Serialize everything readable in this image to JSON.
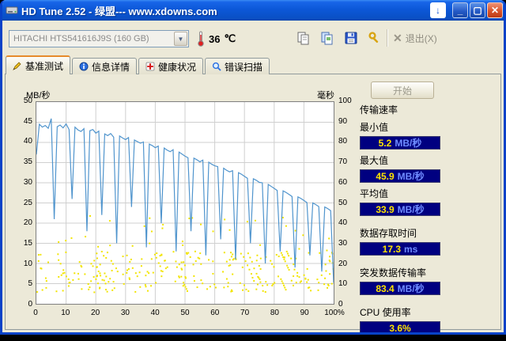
{
  "window": {
    "title": "HD Tune 2.52 - 绿盟--- www.xdowns.com",
    "controls": {
      "download": "↓",
      "minimize": "_",
      "maximize": "▢",
      "close": "✕"
    }
  },
  "toolbar": {
    "drive_select": "HITACHI HTS541616J9S (160 GB)",
    "drive_dropdown_glyph": "▼",
    "temperature_value": "36",
    "temperature_unit": "℃",
    "exit_x_glyph": "✕",
    "exit_label": "退出(X)"
  },
  "icons": [
    "hdd-app-icon",
    "download-icon",
    "thermometer-icon",
    "copy-icon",
    "copy-image-icon",
    "save-icon",
    "settings-icon",
    "exit-x-icon",
    "benchmark-tab-icon",
    "info-tab-icon",
    "health-tab-icon",
    "scan-tab-icon",
    "dropdown-arrow-icon"
  ],
  "tabs": [
    {
      "label": "基准测试",
      "active": true
    },
    {
      "label": "信息详情",
      "active": false
    },
    {
      "label": "健康状况",
      "active": false
    },
    {
      "label": "错误扫描",
      "active": false
    }
  ],
  "page": {
    "start_button": "开始",
    "axis_left_title": "MB/秒",
    "axis_right_title": "毫秒"
  },
  "results": {
    "transfer_header": "传输速率",
    "min_label": "最小值",
    "min_value": "5.2",
    "min_unit": "MB/秒",
    "max_label": "最大值",
    "max_value": "45.9",
    "max_unit": "MB/秒",
    "avg_label": "平均值",
    "avg_value": "33.9",
    "avg_unit": "MB/秒",
    "access_label": "数据存取时间",
    "access_value": "17.3",
    "access_unit": "ms",
    "burst_label": "突发数据传输率",
    "burst_value": "83.4",
    "burst_unit": "MB/秒",
    "cpu_label": "CPU 使用率",
    "cpu_value": "3.6%"
  },
  "chart_data": {
    "type": "line",
    "title": "HD Tune benchmark transfer rate and access time",
    "x_ticks": [
      "0",
      "10",
      "20",
      "30",
      "40",
      "50",
      "60",
      "70",
      "80",
      "90",
      "100%"
    ],
    "left_ticks": [
      "50",
      "45",
      "40",
      "35",
      "30",
      "25",
      "20",
      "15",
      "10",
      "5",
      "0"
    ],
    "right_ticks": [
      "100",
      "90",
      "80",
      "70",
      "60",
      "50",
      "40",
      "30",
      "20",
      "10",
      "0"
    ],
    "left_range": [
      0,
      50
    ],
    "right_range": [
      0,
      100
    ],
    "x_range": [
      0,
      100
    ],
    "grid": true,
    "series": [
      {
        "name": "transfer-rate-mb-per-s",
        "values": [
          37,
          44.5,
          43.8,
          44.2,
          43.5,
          45.9,
          21,
          43.9,
          44.3,
          43.6,
          44.6,
          43.2,
          26,
          43.8,
          43.1,
          42.7,
          43.4,
          18,
          42.9,
          43.2,
          42.3,
          42.8,
          22,
          42.1,
          41.7,
          42.2,
          41.3,
          15,
          41.6,
          41.1,
          40.7,
          41.2,
          24,
          40.6,
          40.2,
          39.8,
          40.1,
          14,
          39.6,
          39.2,
          38.7,
          39.1,
          20,
          38.6,
          38.1,
          37.7,
          38.2,
          13,
          37.6,
          37.1,
          36.6,
          36.2,
          18,
          36.1,
          35.7,
          35.2,
          35.6,
          12,
          35.1,
          34.6,
          34.2,
          34,
          16,
          33.6,
          33.1,
          32.7,
          33,
          11,
          32.5,
          32.1,
          31.6,
          31.1,
          15,
          31,
          30.6,
          30.1,
          30,
          10,
          29.6,
          29.1,
          28.6,
          28.1,
          13,
          28,
          27.6,
          27.1,
          26.6,
          9,
          26.5,
          26.1,
          25.6,
          25.1,
          12,
          25,
          24.6,
          24.1,
          8,
          24,
          23.6,
          23.1,
          5.2
        ]
      }
    ],
    "access_dots": {
      "count": 330,
      "seed": 97,
      "ms_dense": [
        6,
        26
      ],
      "ms_max": 44
    },
    "colors": {
      "line": "#4f94cd",
      "dots": "#f2e400",
      "grid": "#cfcfcf",
      "plot_bg": "#ffffff"
    }
  }
}
